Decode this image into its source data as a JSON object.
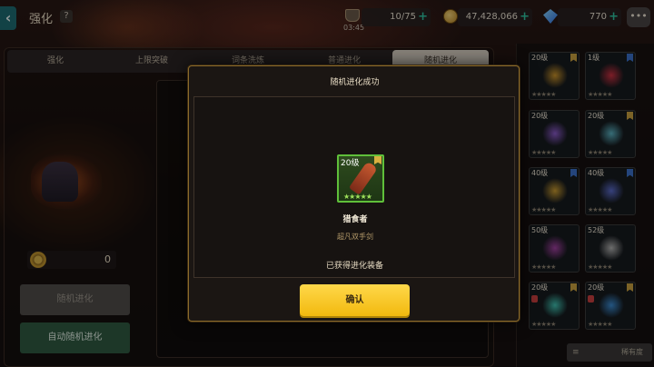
{
  "header": {
    "title": "强化",
    "help_label": "?",
    "back_icon": "chevron-left-icon",
    "stamina": "10/75",
    "timer": "03:45",
    "coins": "47,428,066",
    "gems": "770",
    "plus": "+",
    "chat_icon": "chat-icon"
  },
  "tabs": [
    {
      "label": "强化",
      "active": false
    },
    {
      "label": "上限突破",
      "active": false
    },
    {
      "label": "词条洗炼",
      "active": false
    },
    {
      "label": "普通进化",
      "active": false
    },
    {
      "label": "随机进化",
      "active": true
    }
  ],
  "left_panel": {
    "currency_value": "0",
    "random_evolve_label": "随机进化",
    "auto_random_evolve_label": "自动随机进化"
  },
  "inventory": {
    "sort_label": "稀有度",
    "sort_icon": "≡",
    "slots": [
      {
        "level": "20级",
        "mark": "gold",
        "color": "#c8922a",
        "stars": "★★★★★",
        "lock": false
      },
      {
        "level": "1级",
        "mark": "blue",
        "color": "#c83040",
        "stars": "★★★★★",
        "lock": false
      },
      {
        "level": "20级",
        "mark": "none",
        "color": "#8a5ac8",
        "stars": "★★★★★",
        "lock": false
      },
      {
        "level": "20级",
        "mark": "gold",
        "color": "#5ab0c0",
        "stars": "★★★★★",
        "lock": false
      },
      {
        "level": "40级",
        "mark": "blue",
        "color": "#c89a30",
        "stars": "★★★★★",
        "lock": false
      },
      {
        "level": "40级",
        "mark": "blue",
        "color": "#5a6ac8",
        "stars": "★★★★★",
        "lock": false
      },
      {
        "level": "50级",
        "mark": "none",
        "color": "#a040a0",
        "stars": "★★★★★",
        "lock": false
      },
      {
        "level": "52级",
        "mark": "none",
        "color": "#b0b0b0",
        "stars": "★★★★★",
        "lock": false
      },
      {
        "level": "20级",
        "mark": "gold",
        "color": "#40c0b0",
        "stars": "★★★★★",
        "lock": true
      },
      {
        "level": "20级",
        "mark": "gold",
        "color": "#3a8ad0",
        "stars": "★★★★★",
        "lock": true
      }
    ]
  },
  "modal": {
    "title": "随机进化成功",
    "item_level": "20级",
    "item_stars": "★★★★★",
    "item_name": "猎食者",
    "item_type": "超凡双手剑",
    "obtained_text": "已获得进化装备",
    "confirm_label": "确认",
    "accent_color": "#ffd23a"
  }
}
